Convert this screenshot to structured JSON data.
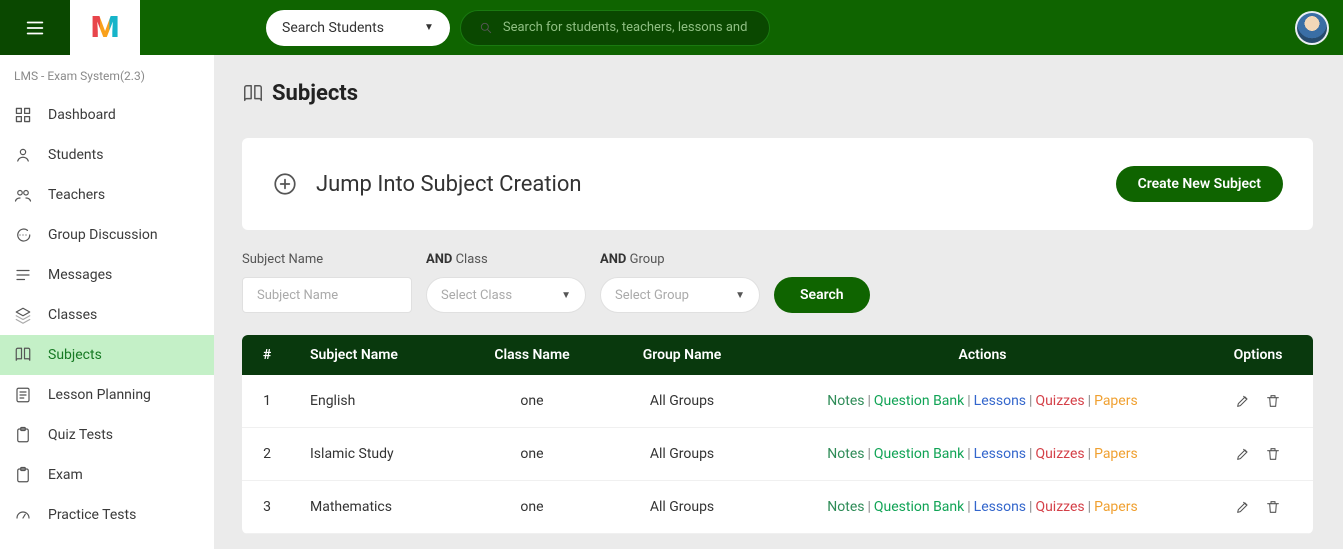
{
  "header": {
    "search_type": "Search Students",
    "search_placeholder": "Search for students, teachers, lessons and more.."
  },
  "sidebar": {
    "system_label": "LMS - Exam System(2.3)",
    "items": [
      {
        "label": "Dashboard"
      },
      {
        "label": "Students"
      },
      {
        "label": "Teachers"
      },
      {
        "label": "Group Discussion"
      },
      {
        "label": "Messages"
      },
      {
        "label": "Classes"
      },
      {
        "label": "Subjects"
      },
      {
        "label": "Lesson Planning"
      },
      {
        "label": "Quiz Tests"
      },
      {
        "label": "Exam"
      },
      {
        "label": "Practice Tests"
      }
    ]
  },
  "main": {
    "page_title": "Subjects",
    "jump_title": "Jump Into Subject Creation",
    "create_button": "Create New Subject",
    "filters": {
      "subject_label": "Subject Name",
      "subject_placeholder": "Subject Name",
      "class_and": "AND",
      "class_label": " Class",
      "class_placeholder": "Select Class",
      "group_and": "AND",
      "group_label": " Group",
      "group_placeholder": "Select Group",
      "search_button": "Search"
    },
    "table": {
      "headers": {
        "idx": "#",
        "subject": "Subject Name",
        "class": "Class Name",
        "group": "Group Name",
        "actions": "Actions",
        "options": "Options"
      },
      "action_labels": {
        "notes": "Notes",
        "qbank": "Question Bank",
        "lessons": "Lessons",
        "quizzes": "Quizzes",
        "papers": "Papers"
      },
      "rows": [
        {
          "idx": "1",
          "subject": "English",
          "class": "one",
          "group": "All Groups"
        },
        {
          "idx": "2",
          "subject": "Islamic Study",
          "class": "one",
          "group": "All Groups"
        },
        {
          "idx": "3",
          "subject": "Mathematics",
          "class": "one",
          "group": "All Groups"
        }
      ]
    }
  }
}
